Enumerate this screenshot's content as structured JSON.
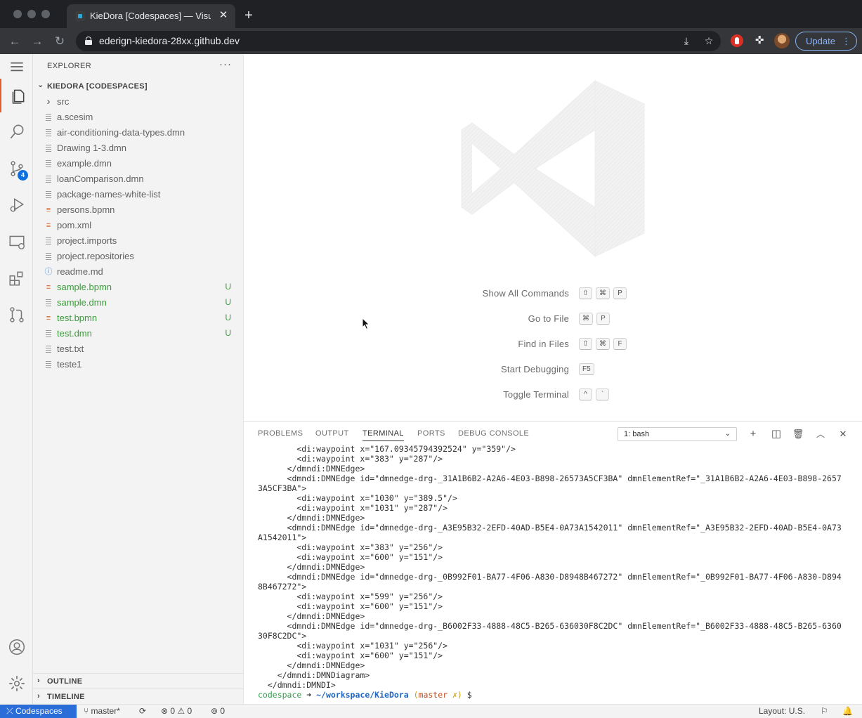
{
  "browser": {
    "tab_title": "KieDora [Codespaces] — Visual Studio Code",
    "url": "ederign-kiedora-28xx.github.dev",
    "update_label": "Update"
  },
  "activity_bar": {
    "scm_badge": "4"
  },
  "sidebar": {
    "title": "EXPLORER",
    "more": "···",
    "folder": "KIEDORA [CODESPACES]",
    "files": [
      {
        "name": "src",
        "icon": "chevron-right-icon",
        "status": ""
      },
      {
        "name": "a.scesim",
        "icon": "file-lines-icon",
        "status": ""
      },
      {
        "name": "air-conditioning-data-types.dmn",
        "icon": "file-lines-icon",
        "status": ""
      },
      {
        "name": "Drawing 1-3.dmn",
        "icon": "file-lines-icon",
        "status": ""
      },
      {
        "name": "example.dmn",
        "icon": "file-lines-icon",
        "status": ""
      },
      {
        "name": "loanComparison.dmn",
        "icon": "file-lines-icon",
        "status": ""
      },
      {
        "name": "package-names-white-list",
        "icon": "file-lines-icon",
        "status": ""
      },
      {
        "name": "persons.bpmn",
        "icon": "rss-icon",
        "status": ""
      },
      {
        "name": "pom.xml",
        "icon": "rss-icon",
        "status": ""
      },
      {
        "name": "project.imports",
        "icon": "file-lines-icon",
        "status": ""
      },
      {
        "name": "project.repositories",
        "icon": "file-lines-icon",
        "status": ""
      },
      {
        "name": "readme.md",
        "icon": "info-icon",
        "status": ""
      },
      {
        "name": "sample.bpmn",
        "icon": "rss-icon",
        "status": "U"
      },
      {
        "name": "sample.dmn",
        "icon": "file-lines-icon",
        "status": "U"
      },
      {
        "name": "test.bpmn",
        "icon": "rss-icon",
        "status": "U"
      },
      {
        "name": "test.dmn",
        "icon": "file-lines-icon",
        "status": "U"
      },
      {
        "name": "test.txt",
        "icon": "file-lines-icon",
        "status": ""
      },
      {
        "name": "teste1",
        "icon": "file-lines-icon",
        "status": ""
      }
    ],
    "outline": "OUTLINE",
    "timeline": "TIMELINE"
  },
  "welcome": {
    "shortcuts": [
      {
        "label": "Show All Commands",
        "keys": [
          "⇧",
          "⌘",
          "P"
        ]
      },
      {
        "label": "Go to File",
        "keys": [
          "⌘",
          "P"
        ]
      },
      {
        "label": "Find in Files",
        "keys": [
          "⇧",
          "⌘",
          "F"
        ]
      },
      {
        "label": "Start Debugging",
        "keys": [
          "F5"
        ]
      },
      {
        "label": "Toggle Terminal",
        "keys": [
          "^",
          "`"
        ]
      }
    ]
  },
  "panel": {
    "tabs": [
      "PROBLEMS",
      "OUTPUT",
      "TERMINAL",
      "PORTS",
      "DEBUG CONSOLE"
    ],
    "active_tab": "TERMINAL",
    "terminal_select": "1: bash",
    "terminal_lines": [
      "        <di:waypoint x=\"167.09345794392524\" y=\"359\"/>",
      "        <di:waypoint x=\"383\" y=\"287\"/>",
      "      </dmndi:DMNEdge>",
      "      <dmndi:DMNEdge id=\"dmnedge-drg-_31A1B6B2-A2A6-4E03-B898-26573A5CF3BA\" dmnElementRef=\"_31A1B6B2-A2A6-4E03-B898-2657",
      "3A5CF3BA\">",
      "        <di:waypoint x=\"1030\" y=\"389.5\"/>",
      "        <di:waypoint x=\"1031\" y=\"287\"/>",
      "      </dmndi:DMNEdge>",
      "      <dmndi:DMNEdge id=\"dmnedge-drg-_A3E95B32-2EFD-40AD-B5E4-0A73A1542011\" dmnElementRef=\"_A3E95B32-2EFD-40AD-B5E4-0A73",
      "A1542011\">",
      "        <di:waypoint x=\"383\" y=\"256\"/>",
      "        <di:waypoint x=\"600\" y=\"151\"/>",
      "      </dmndi:DMNEdge>",
      "      <dmndi:DMNEdge id=\"dmnedge-drg-_0B992F01-BA77-4F06-A830-D8948B467272\" dmnElementRef=\"_0B992F01-BA77-4F06-A830-D894",
      "8B467272\">",
      "        <di:waypoint x=\"599\" y=\"256\"/>",
      "        <di:waypoint x=\"600\" y=\"151\"/>",
      "      </dmndi:DMNEdge>",
      "      <dmndi:DMNEdge id=\"dmnedge-drg-_B6002F33-4888-48C5-B265-636030F8C2DC\" dmnElementRef=\"_B6002F33-4888-48C5-B265-6360",
      "30F8C2DC\">",
      "        <di:waypoint x=\"1031\" y=\"256\"/>",
      "        <di:waypoint x=\"600\" y=\"151\"/>",
      "      </dmndi:DMNEdge>",
      "    </dmndi:DMNDiagram>",
      "  </dmndi:DMNDI>"
    ],
    "prompt": {
      "user": "codespace",
      "arrow": " ➜ ",
      "path": "~/workspace/KieDora",
      "branch_open": " (",
      "branch": "master",
      "dirty": " ✗",
      "branch_close": ")",
      "suffix": " $"
    }
  },
  "statusbar": {
    "remote": "Codespaces",
    "branch": "master*",
    "errors": "0",
    "warnings": "0",
    "ports": "0",
    "layout": "Layout: U.S."
  },
  "colors": {
    "accent": "#2a6cd8",
    "untracked": "#3d9b3d",
    "active_indicator": "#e55d2b"
  }
}
